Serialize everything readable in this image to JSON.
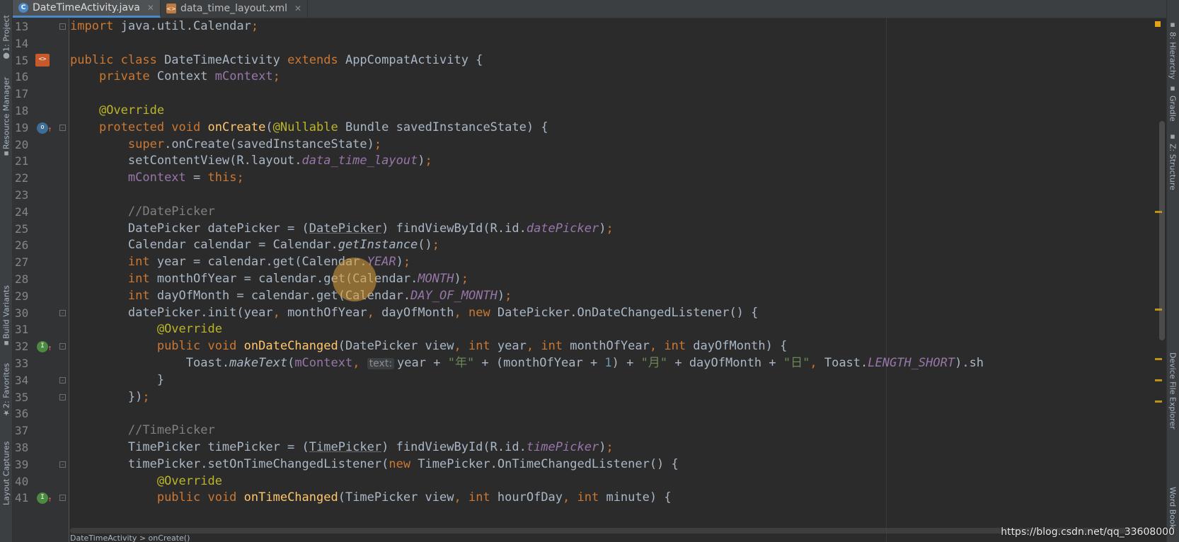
{
  "tabs": [
    {
      "label": "DateTimeActivity.java",
      "icon": "java-class-icon",
      "active": true
    },
    {
      "label": "data_time_layout.xml",
      "icon": "xml-file-icon",
      "active": false
    }
  ],
  "left_tool_windows": [
    "1: Project",
    "Resource Manager",
    "Build Variants",
    "2: Favorites",
    "Layout Captures"
  ],
  "right_tool_windows": [
    "8: Hierarchy",
    "Gradle",
    "Z: Structure",
    "Device File Explorer",
    "Word Book"
  ],
  "line_numbers": [
    "13",
    "14",
    "15",
    "16",
    "17",
    "18",
    "19",
    "20",
    "21",
    "22",
    "23",
    "24",
    "25",
    "26",
    "27",
    "28",
    "29",
    "30",
    "31",
    "32",
    "33",
    "34",
    "35",
    "36",
    "37",
    "38",
    "39",
    "40",
    "41"
  ],
  "code_lines": [
    "import java.util.Calendar;",
    "",
    "public class DateTimeActivity extends AppCompatActivity {",
    "    private Context mContext;",
    "",
    "    @Override",
    "    protected void onCreate(@Nullable Bundle savedInstanceState) {",
    "        super.onCreate(savedInstanceState);",
    "        setContentView(R.layout.data_time_layout);",
    "        mContext = this;",
    "",
    "        //DatePicker",
    "        DatePicker datePicker = (DatePicker) findViewById(R.id.datePicker);",
    "        Calendar calendar = Calendar.getInstance();",
    "        int year = calendar.get(Calendar.YEAR);",
    "        int monthOfYear = calendar.get(Calendar.MONTH);",
    "        int dayOfMonth = calendar.get(Calendar.DAY_OF_MONTH);",
    "        datePicker.init(year, monthOfYear, dayOfMonth, new DatePicker.OnDateChangedListener() {",
    "            @Override",
    "            public void onDateChanged(DatePicker view, int year, int monthOfYear, int dayOfMonth) {",
    "                Toast.makeText(mContext, text: year + \"年\" + (monthOfYear + 1) + \"月\" + dayOfMonth + \"日\", Toast.LENGTH_SHORT).sh",
    "            }",
    "        });",
    "",
    "        //TimePicker",
    "        TimePicker timePicker = (TimePicker) findViewById(R.id.timePicker);",
    "        timePicker.setOnTimeChangedListener(new TimePicker.OnTimeChangedListener() {",
    "            @Override",
    "            public void onTimeChanged(TimePicker view, int hourOfDay, int minute) {"
  ],
  "param_hint": "text:",
  "breadcrumb": "DateTimeActivity  >  onCreate()",
  "watermark": "https://blog.csdn.net/qq_33608000",
  "colors": {
    "keyword": "#cc7832",
    "annotation": "#bbb529",
    "method": "#ffc66d",
    "field": "#9876aa",
    "comment": "#808080",
    "number": "#6897bb",
    "string": "#6a8759"
  }
}
